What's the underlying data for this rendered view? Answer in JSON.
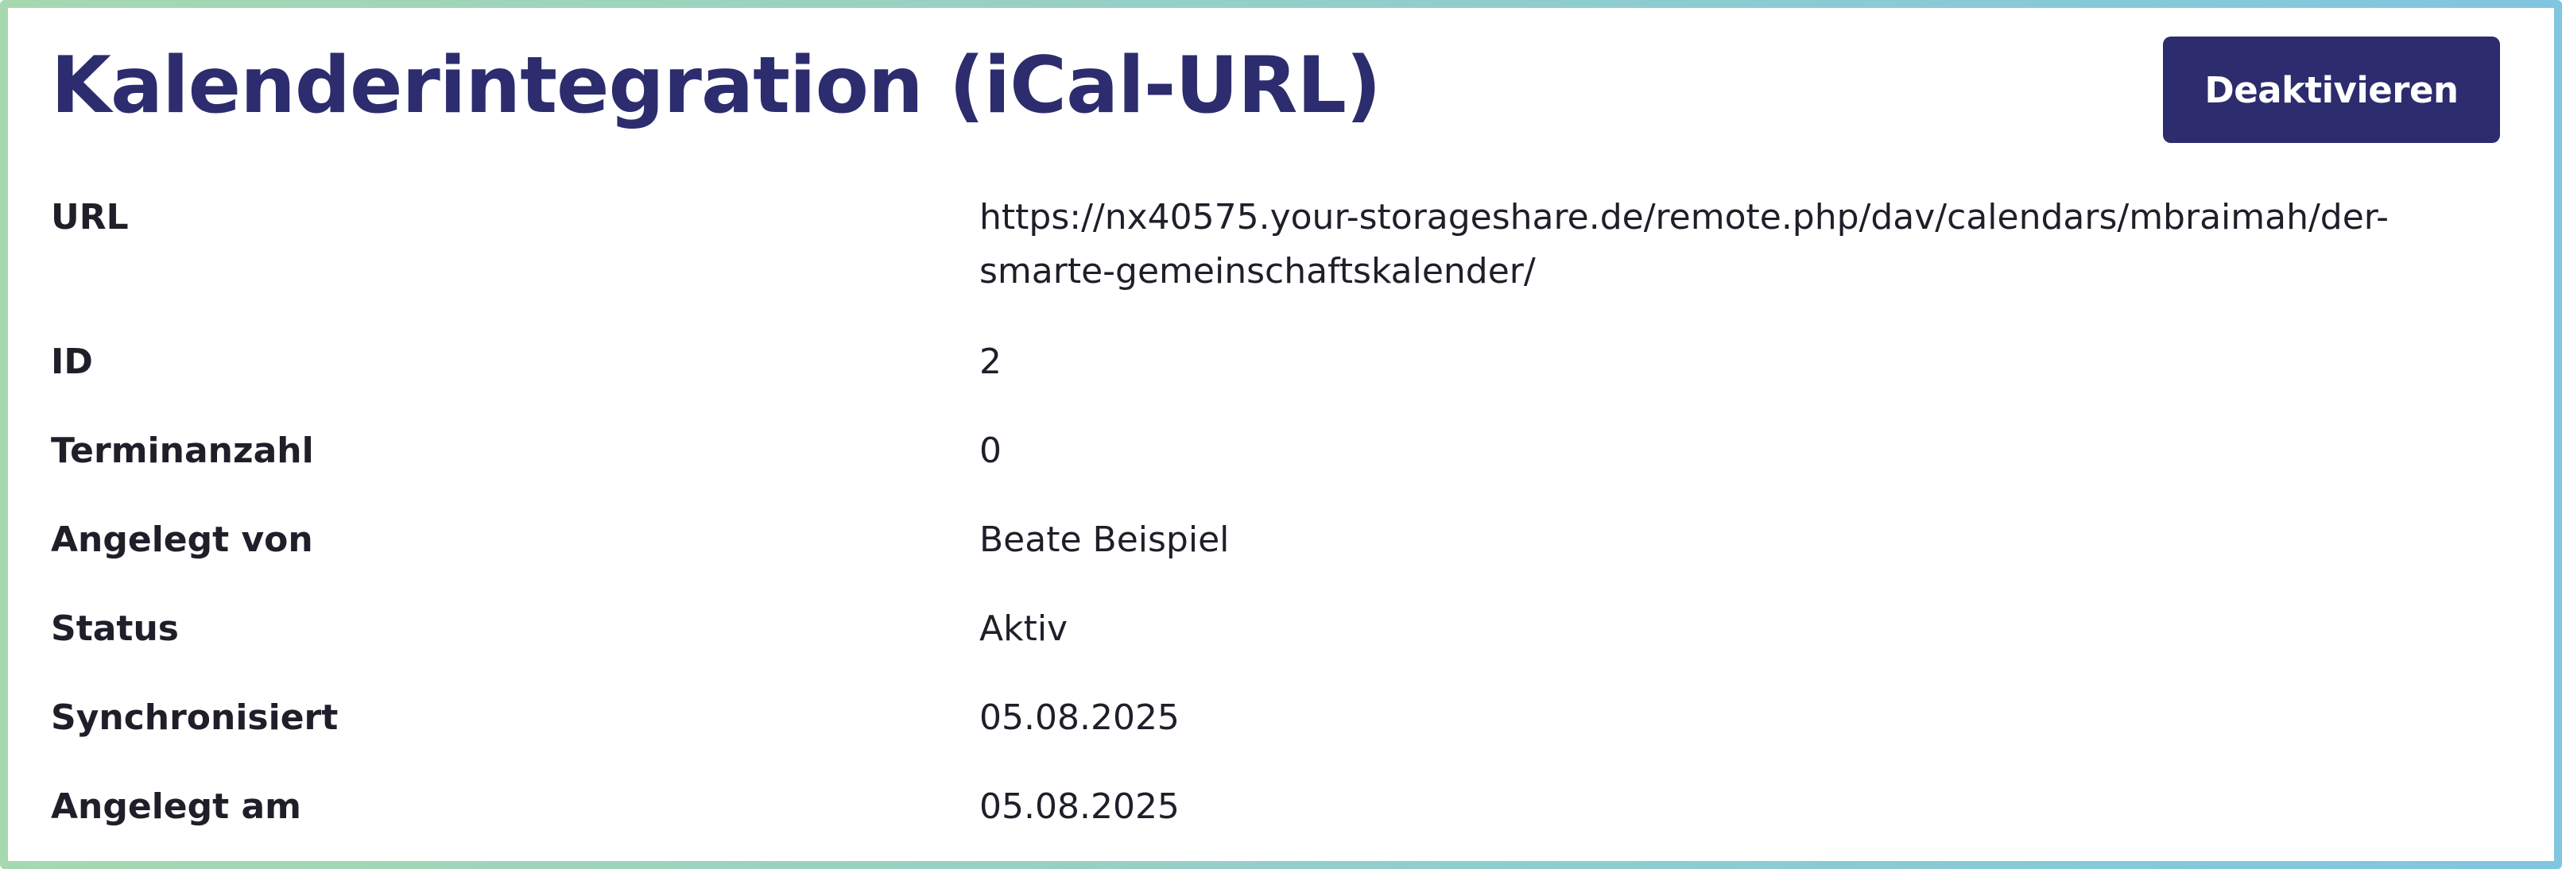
{
  "header": {
    "title": "Kalenderintegration (iCal-URL)",
    "deactivate_label": "Deaktivieren"
  },
  "details": {
    "url": {
      "label": "URL",
      "value_line1": "https://nx40575.your-storageshare.de/remote.php/dav/calendars/mbraimah/der-",
      "value_line2": "smarte-gemeinschaftskalender/"
    },
    "id": {
      "label": "ID",
      "value": "2"
    },
    "event_count": {
      "label": "Terminanzahl",
      "value": "0"
    },
    "created_by": {
      "label": "Angelegt von",
      "value": "Beate Beispiel"
    },
    "status": {
      "label": "Status",
      "value": "Aktiv"
    },
    "synced": {
      "label": "Synchronisiert",
      "value": "05.08.2025"
    },
    "created_at": {
      "label": "Angelegt am",
      "value": "05.08.2025"
    }
  },
  "colors": {
    "accent": "#2c2c6e",
    "text": "#1f1f2a",
    "border_gradient_start": "#a6d8b0",
    "border_gradient_end": "#7fc6e0"
  }
}
